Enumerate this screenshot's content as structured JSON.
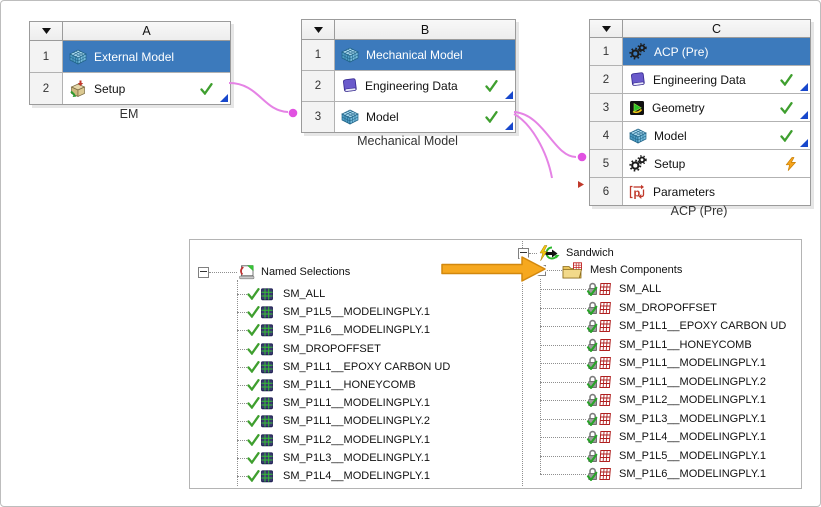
{
  "colors": {
    "selected_row_blue": "#3c7abc",
    "connector_pink": "#e583e5",
    "connector_dot_magenta": "#e152e1",
    "highlight_arrow_orange": "#f6a81f",
    "check_green": "#3f9f2f",
    "corner_blue": "#1848cc",
    "lightning_orange": "#f6a41c",
    "parameters_red": "#c0392b"
  },
  "schematic": {
    "systems": [
      {
        "key": "A",
        "header_letter": "A",
        "caption": "EM",
        "rows": [
          {
            "num": "1",
            "icon": "mesh-block-icon",
            "label": "External Model",
            "selected": true,
            "status": []
          },
          {
            "num": "2",
            "icon": "setup-import-icon",
            "label": "Setup",
            "selected": false,
            "status": [
              "check",
              "corner"
            ]
          }
        ]
      },
      {
        "key": "B",
        "header_letter": "B",
        "caption": "Mechanical Model",
        "rows": [
          {
            "num": "1",
            "icon": "mesh-block-icon",
            "label": "Mechanical Model",
            "selected": true,
            "status": []
          },
          {
            "num": "2",
            "icon": "book-icon",
            "label": "Engineering Data",
            "selected": false,
            "status": [
              "check",
              "corner"
            ]
          },
          {
            "num": "3",
            "icon": "mesh-block-icon",
            "label": "Model",
            "selected": false,
            "status": [
              "check",
              "corner"
            ]
          }
        ]
      },
      {
        "key": "C",
        "header_letter": "C",
        "caption": "ACP (Pre)",
        "rows": [
          {
            "num": "1",
            "icon": "gears-icon",
            "label": "ACP (Pre)",
            "selected": true,
            "status": []
          },
          {
            "num": "2",
            "icon": "book-icon",
            "label": "Engineering Data",
            "selected": false,
            "status": [
              "check",
              "corner"
            ]
          },
          {
            "num": "3",
            "icon": "geometry-icon",
            "label": "Geometry",
            "selected": false,
            "status": [
              "check",
              "corner"
            ]
          },
          {
            "num": "4",
            "icon": "mesh-block-icon",
            "label": "Model",
            "selected": false,
            "status": [
              "check",
              "corner"
            ]
          },
          {
            "num": "5",
            "icon": "gears-icon",
            "label": "Setup",
            "selected": false,
            "status": [
              "lightning"
            ]
          },
          {
            "num": "6",
            "icon": "parameters-icon",
            "label": "Parameters",
            "selected": false,
            "status": []
          }
        ]
      }
    ]
  },
  "trees": {
    "left": {
      "root_label": "Named Selections",
      "root_icon": "named-selections-icon",
      "item_icons": [
        "check-icon",
        "ns-grid-icon"
      ],
      "items": [
        "SM_ALL",
        "SM_P1L5__MODELINGPLY.1",
        "SM_P1L6__MODELINGPLY.1",
        "SM_DROPOFFSET",
        "SM_P1L1__EPOXY CARBON UD",
        "SM_P1L1__HONEYCOMB",
        "SM_P1L1__MODELINGPLY.1",
        "SM_P1L1__MODELINGPLY.2",
        "SM_P1L2__MODELINGPLY.1",
        "SM_P1L3__MODELINGPLY.1",
        "SM_P1L4__MODELINGPLY.1"
      ]
    },
    "right": {
      "root_label": "Sandwich",
      "root_icon": "sandwich-update-icon",
      "group_label": "Mesh Components",
      "group_icon": "mesh-folder-icon",
      "item_icons": [
        "lock-check-icon",
        "red-grid-icon"
      ],
      "items": [
        "SM_ALL",
        "SM_DROPOFFSET",
        "SM_P1L1__EPOXY CARBON UD",
        "SM_P1L1__HONEYCOMB",
        "SM_P1L1__MODELINGPLY.1",
        "SM_P1L1__MODELINGPLY.2",
        "SM_P1L2__MODELINGPLY.1",
        "SM_P1L3__MODELINGPLY.1",
        "SM_P1L4__MODELINGPLY.1",
        "SM_P1L5__MODELINGPLY.1",
        "SM_P1L6__MODELINGPLY.1"
      ]
    }
  }
}
